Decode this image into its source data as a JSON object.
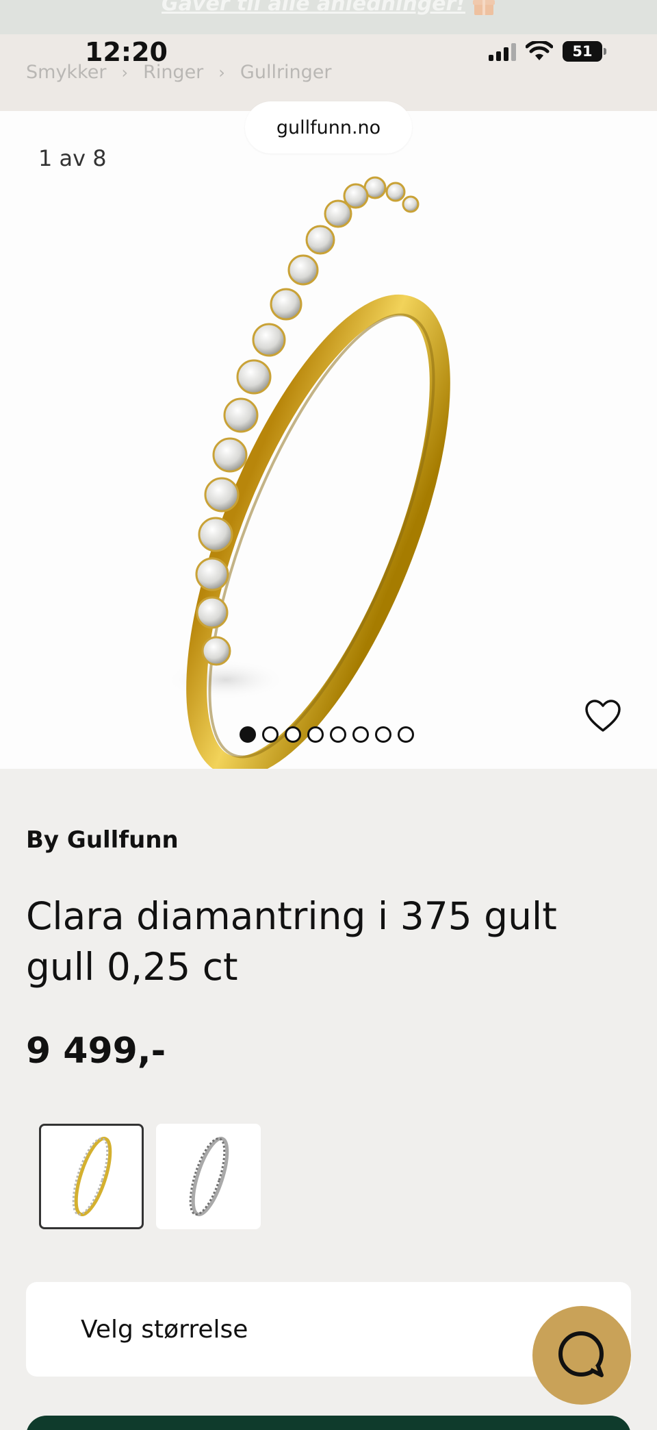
{
  "promo": {
    "text": "Gaver til alle anledninger!",
    "icon": "gift-icon"
  },
  "status_bar": {
    "time": "12:20",
    "battery": "51",
    "icons": [
      "signal-icon",
      "wifi-icon",
      "battery-icon"
    ]
  },
  "breadcrumb": {
    "items": [
      "Smykker",
      "Ringer",
      "Gullringer"
    ],
    "separator": "›"
  },
  "browser": {
    "url": "gullfunn.no"
  },
  "gallery": {
    "counter": "1 av 8",
    "total": 8,
    "active_index": 0,
    "favorite_icon": "heart-icon"
  },
  "product": {
    "brand": "By Gullfunn",
    "title": "Clara diamantring i 375 gult gull 0,25 ct",
    "price": "9 499,-",
    "variants": [
      {
        "name": "gold",
        "selected": true
      },
      {
        "name": "white-gold",
        "selected": false
      }
    ],
    "size_select_label": "Velg størrelse"
  },
  "chat": {
    "icon": "chat-icon"
  },
  "colors": {
    "accent_gold": "#c9a258",
    "cta_green": "#0f3b2c",
    "background": "#f0efed"
  }
}
